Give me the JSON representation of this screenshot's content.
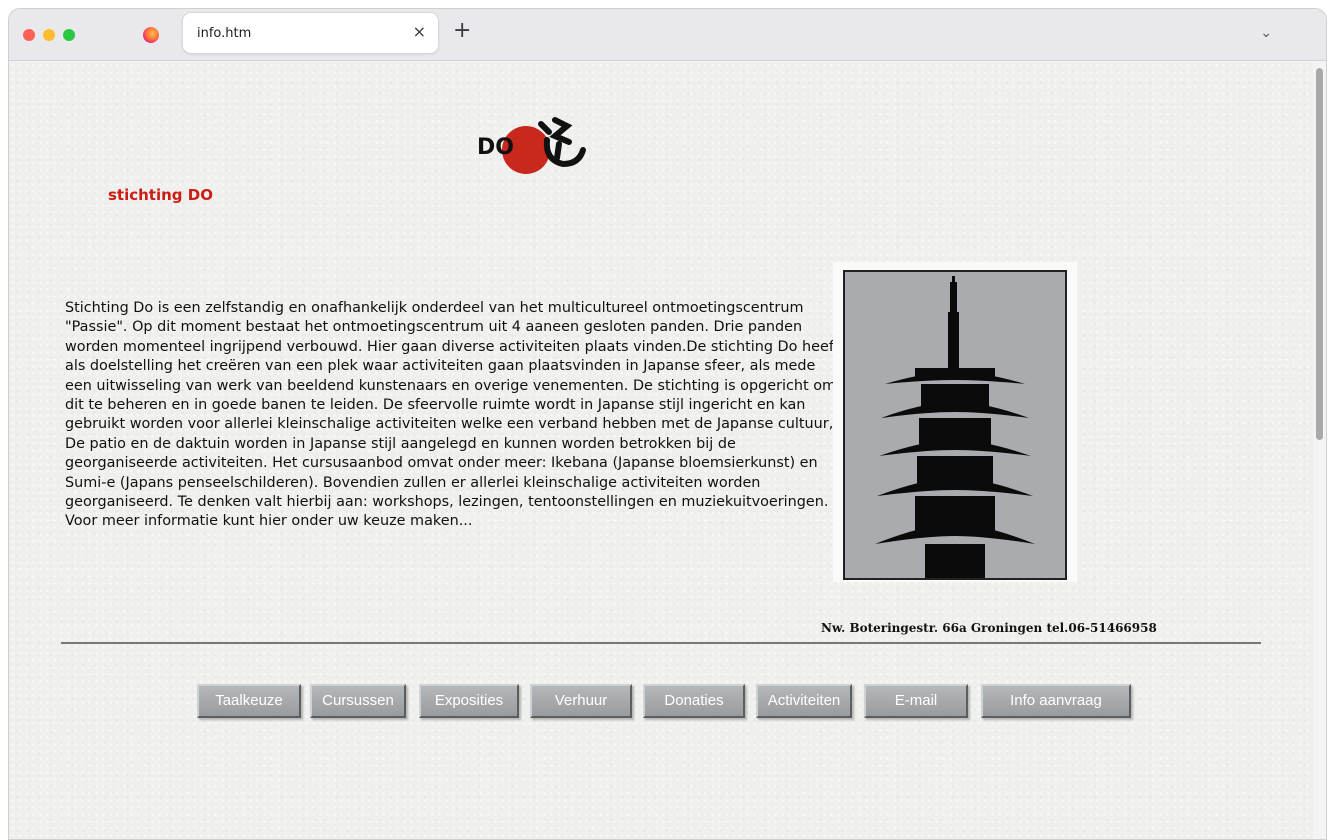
{
  "browser": {
    "tab_title": "info.htm",
    "tab_close": "×",
    "new_tab": "+",
    "tab_list": "⌄",
    "accent_red": "#ff5f57",
    "accent_yellow": "#febc2e",
    "accent_green": "#28c840"
  },
  "page": {
    "logo_text": "DO",
    "org_title": "stichting DO",
    "intro": "Stichting Do is een zelfstandig en onafhankelijk onderdeel van het multicultureel ontmoetingscentrum \"Passie\". Op dit moment bestaat het ontmoetingscentrum uit 4 aaneen gesloten panden. Drie panden worden momenteel ingrijpend verbouwd. Hier gaan diverse activiteiten plaats vinden.De stichting Do heeft als doelstelling het creëren van een plek waar activiteiten gaan plaatsvinden in Japanse sfeer, als mede een uitwisseling van werk van beeldend kunstenaars en overige venementen. De stichting is opgericht om dit te beheren en in goede banen te leiden. De sfeervolle ruimte wordt in Japanse stijl ingericht en kan gebruikt worden voor allerlei kleinschalige activiteiten welke een verband hebben met de Japanse cultuur, De patio en de daktuin worden in Japanse stijl aangelegd en kunnen worden betrokken bij de georganiseerde activiteiten. Het cursusaanbod omvat onder meer: Ikebana (Japanse bloemsierkunst) en Sumi-e (Japans penseelschilderen). Bovendien zullen er allerlei kleinschalige activiteiten worden georganiseerd. Te denken valt hierbij aan: workshops, lezingen, tentoonstellingen en muziekuitvoeringen. Voor meer informatie kunt hier onder uw keuze maken...",
    "address": "Nw. Boteringestr. 66a  Groningen  tel.06-51466958",
    "title_color": "#cc1d15",
    "logo_sun_color": "#c9281c"
  },
  "nav": {
    "items": [
      "Taalkeuze",
      "Cursussen",
      "Exposities",
      "Verhuur",
      "Donaties",
      "Activiteiten",
      "E-mail",
      "Info aanvraag"
    ]
  }
}
